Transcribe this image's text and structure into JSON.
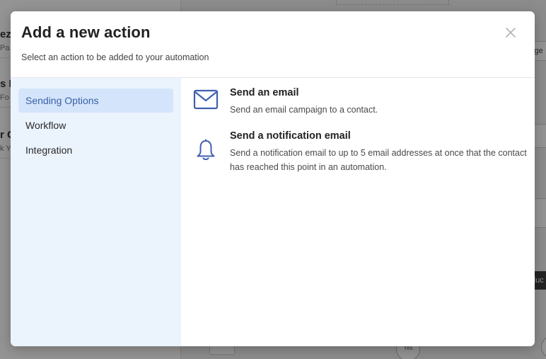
{
  "background": {
    "cards": [
      {
        "title": "ez",
        "subtitle": "Pa"
      },
      {
        "title": "s R",
        "subtitle": "Fo"
      },
      {
        "title": "r C",
        "subtitle": "k Yo"
      }
    ],
    "trigger_label": "igge",
    "dark_button_label": "duc",
    "circle_label": "Yes"
  },
  "modal": {
    "title": "Add a new action",
    "subtitle": "Select an action to be added to your automation",
    "close_icon": "close-icon",
    "sidebar": {
      "items": [
        {
          "label": "Sending Options",
          "active": true
        },
        {
          "label": "Workflow",
          "active": false
        },
        {
          "label": "Integration",
          "active": false
        }
      ]
    },
    "actions": [
      {
        "icon": "envelope-icon",
        "title": "Send an email",
        "description": "Send an email campaign to a contact."
      },
      {
        "icon": "bell-icon",
        "title": "Send a notification email",
        "description": "Send a notification email to up to 5 email addresses at once that the contact has reached this point in an automation."
      }
    ]
  },
  "colors": {
    "accent": "#3f5fb0",
    "sidebar_bg": "#ebf3fd",
    "sidebar_active_bg": "#d4e5fb",
    "overlay": "rgba(0,0,0,0.42)"
  }
}
